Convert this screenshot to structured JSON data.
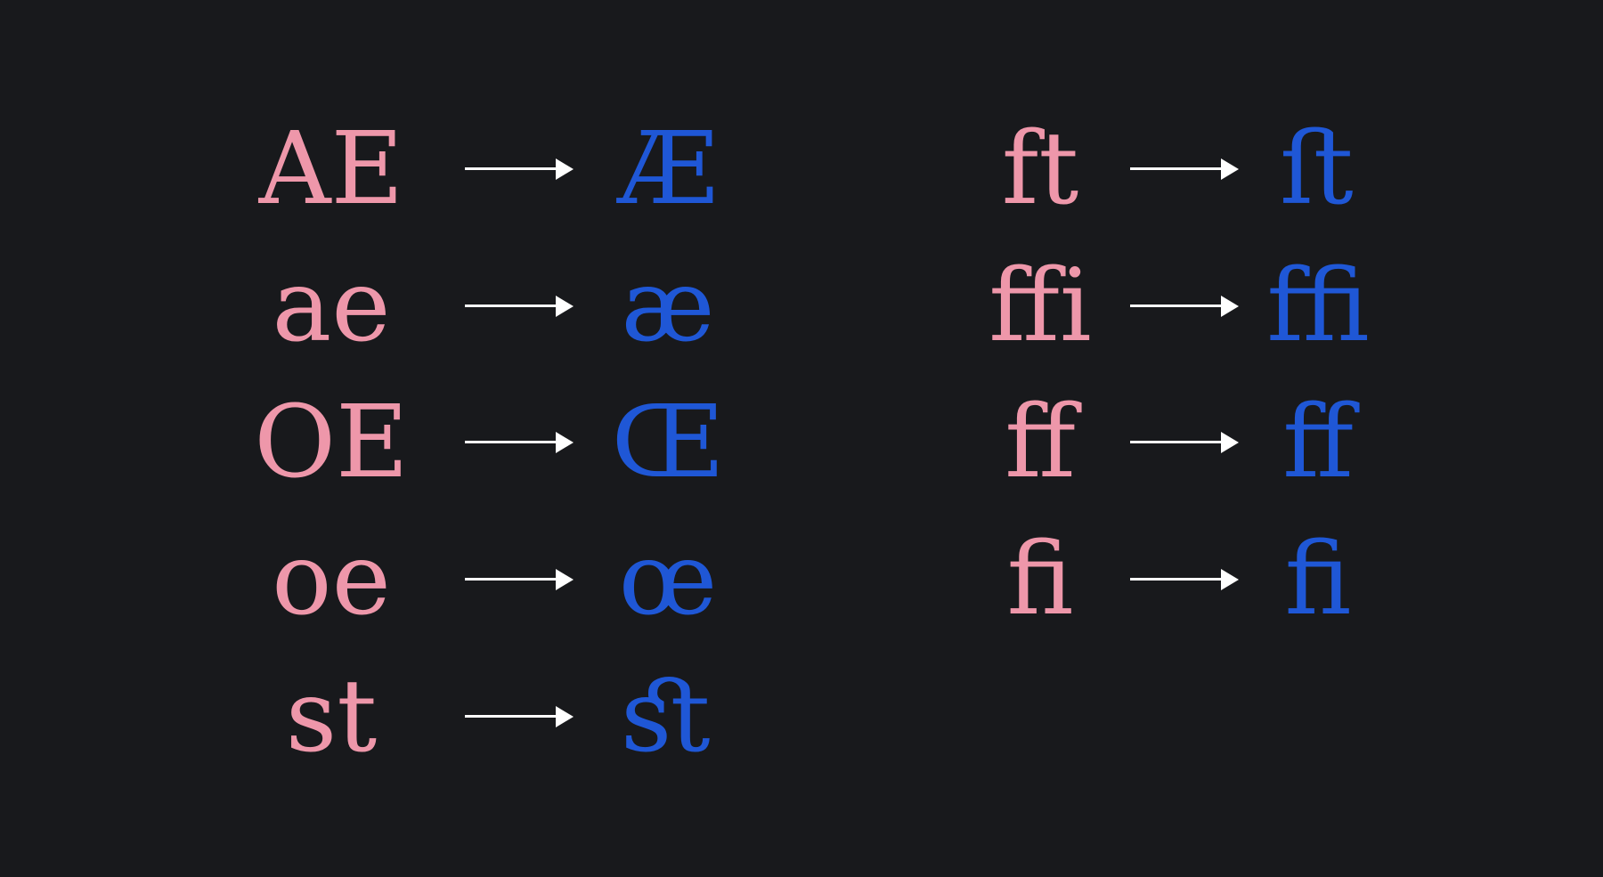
{
  "left_pairs": [
    {
      "source": "AE",
      "ligature": "Æ"
    },
    {
      "source": "ae",
      "ligature": "æ"
    },
    {
      "source": "OE",
      "ligature": "Œ"
    },
    {
      "source": "oe",
      "ligature": "œ"
    },
    {
      "source": "st",
      "ligature": "ﬆ"
    }
  ],
  "right_pairs": [
    {
      "source": "ft",
      "ligature": "ﬅ"
    },
    {
      "source": "ffi",
      "ligature": "ﬃ"
    },
    {
      "source": "ff",
      "ligature": "ﬀ"
    },
    {
      "source": "fi",
      "ligature": "ﬁ"
    }
  ],
  "colors": {
    "background": "#18191c",
    "source": "#ee97aa",
    "ligature": "#1f57d6",
    "arrow": "#ffffff"
  }
}
